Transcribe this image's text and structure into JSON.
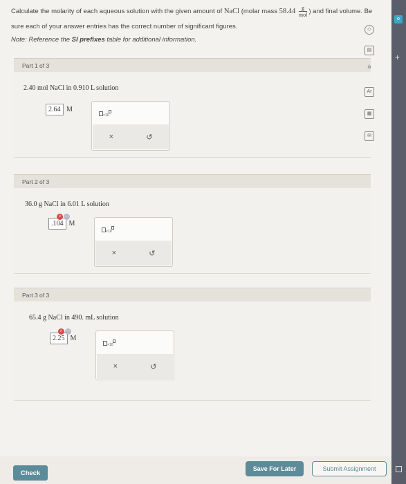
{
  "question": {
    "text_before": "Calculate the molarity of each aqueous solution with the given amount of ",
    "compound": "NaCl",
    "molar_mass_prefix": " (molar mass ",
    "molar_mass_value": "58.44",
    "unit_num": "g",
    "unit_den": "mol",
    "text_after": ") and final volume. Be sure each of your answer entries has the correct number of significant figures.",
    "note_prefix": "Note: Reference the ",
    "note_bold": "SI prefixes",
    "note_suffix": " table for additional information."
  },
  "parts": [
    {
      "header": "Part 1 of 3",
      "prompt": "2.40 mol NaCl in 0.910 L solution",
      "answer": "2.64",
      "unit": "M",
      "status": "entered"
    },
    {
      "header": "Part 2 of 3",
      "prompt": "36.0 g NaCl in 6.01 L solution",
      "answer": ".104",
      "unit": "M",
      "status": "incorrect"
    },
    {
      "header": "Part 3 of 3",
      "prompt": "65.4 g NaCl in 490. mL solution",
      "answer": "2.25",
      "unit": "M",
      "status": "incorrect"
    }
  ],
  "tool": {
    "clear_symbol": "×",
    "undo_symbol": "↺",
    "x10_label": "×10"
  },
  "badge": {
    "x_symbol": "×",
    "m_symbol": "⋯"
  },
  "sidebar": {
    "icons": [
      "chevron-icon",
      "calculator-icon",
      "chart-icon",
      "periodic-table-icon",
      "grid-icon",
      "mail-icon"
    ],
    "symbols": {
      "chevron": "◇",
      "calculator": "▤",
      "chart": "ılı",
      "periodic_table": "Ar",
      "grid": "▦",
      "mail": "✉"
    }
  },
  "edge": {
    "tab": "o",
    "plus": "+"
  },
  "buttons": {
    "check": "Check",
    "save": "Save For Later",
    "submit": "Submit Assignment"
  },
  "colors": {
    "accent": "#5c8b9a",
    "error": "#d84a4a"
  }
}
